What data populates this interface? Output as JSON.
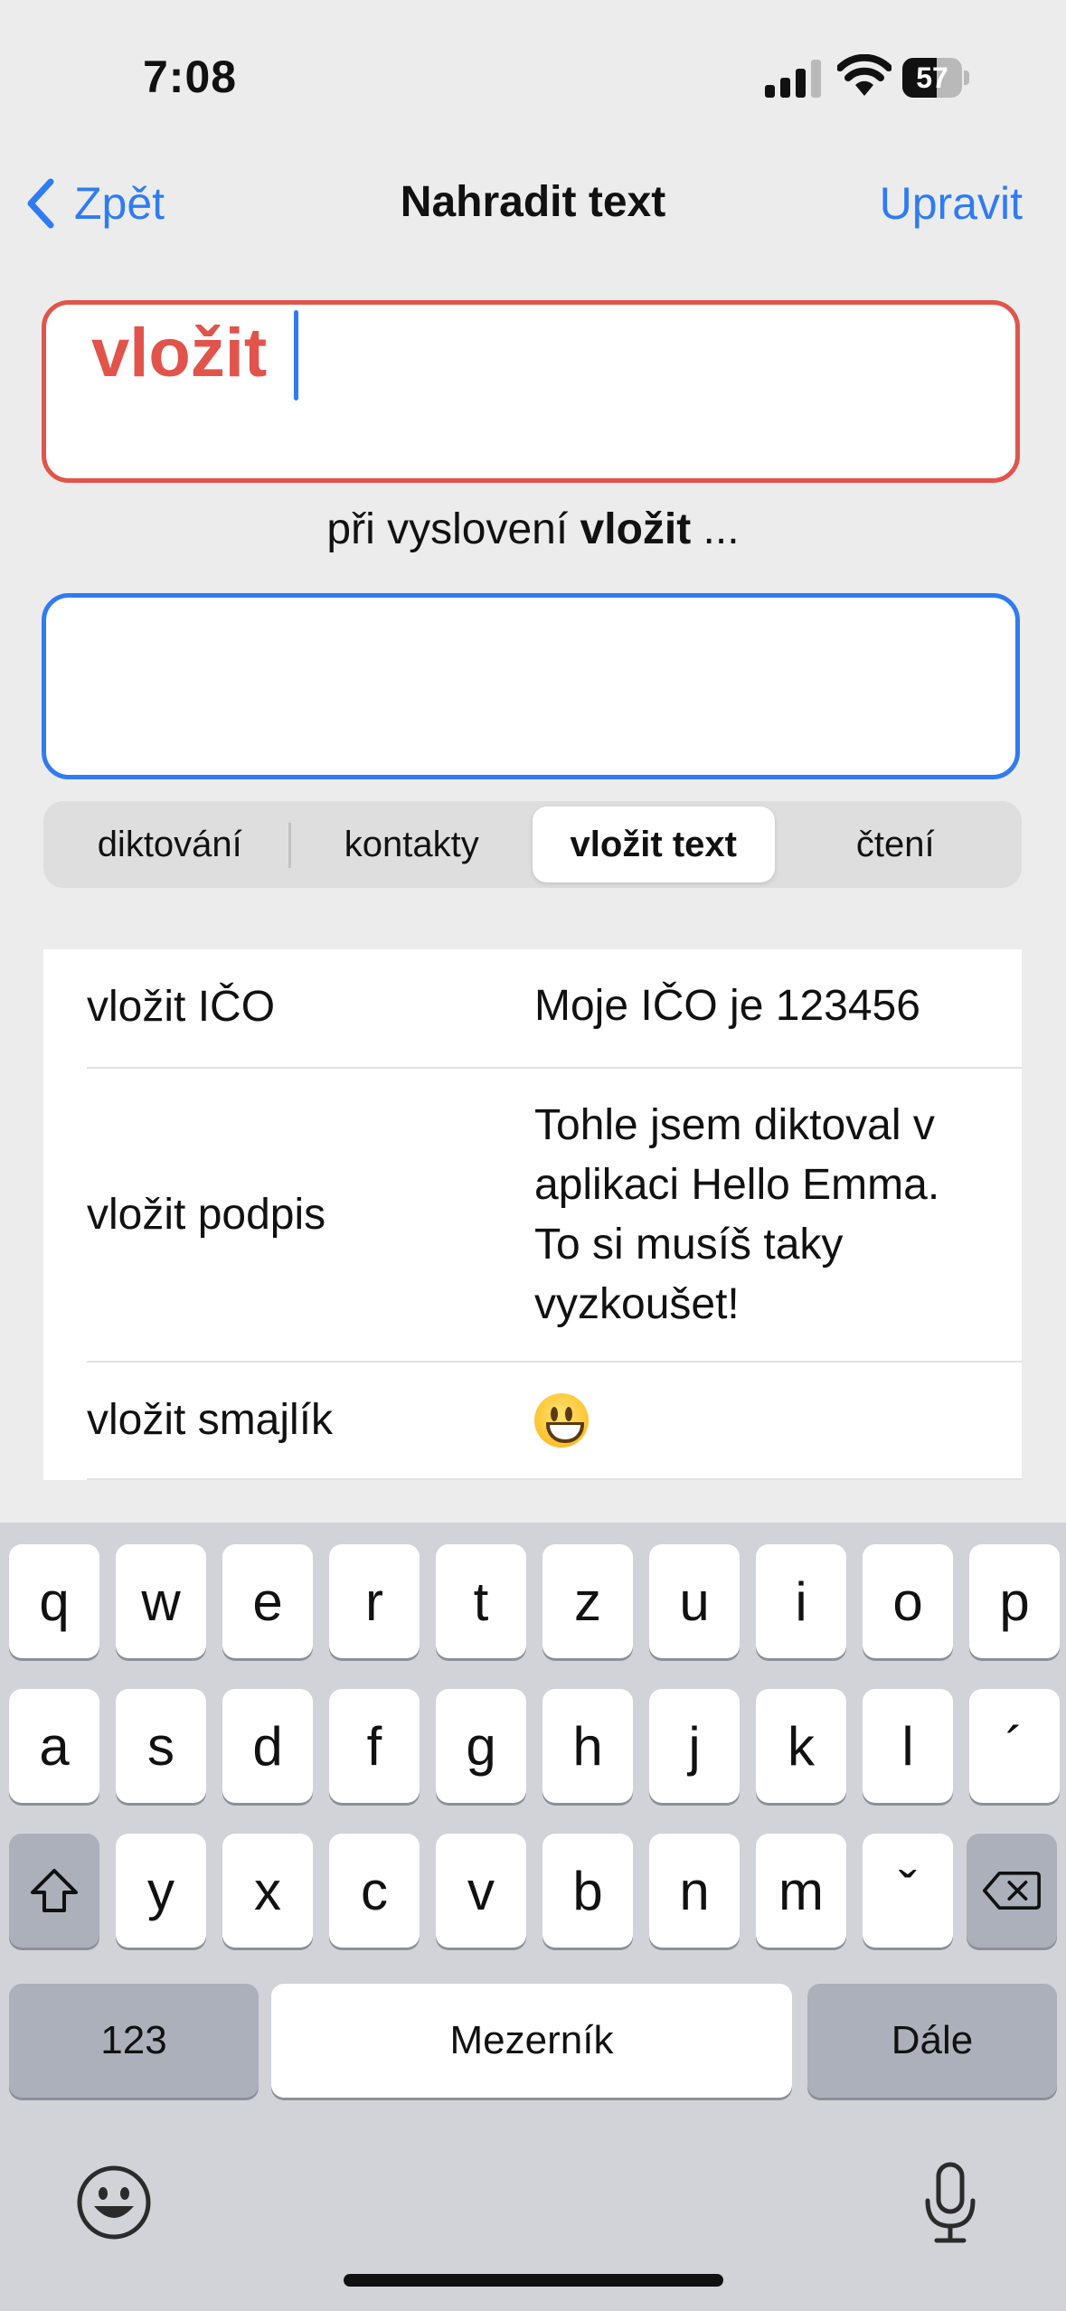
{
  "status_bar": {
    "time": "7:08",
    "battery": "57",
    "battery_level": 0.57
  },
  "nav": {
    "back_label": "Zpět",
    "title": "Nahradit text",
    "edit_label": "Upravit"
  },
  "phrase_field": {
    "value": "vložit"
  },
  "caption": {
    "prefix": "při vyslovení",
    "phrase": "vložit",
    "suffix": "..."
  },
  "replacement_field": {
    "value": ""
  },
  "segments": [
    {
      "label": "diktování",
      "selected": false
    },
    {
      "label": "kontakty",
      "selected": false
    },
    {
      "label": "vložit text",
      "selected": true
    },
    {
      "label": "čtení",
      "selected": false
    }
  ],
  "rows": [
    {
      "phrase": "vložit IČO",
      "text": "Moje IČO je 123456"
    },
    {
      "phrase": "vložit podpis",
      "text": "Tohle jsem diktoval v aplikaci Hello Emma. To si musíš taky vyzkoušet!"
    },
    {
      "phrase": "vložit smajlík",
      "text": "",
      "icon": "grinning-face-emoji"
    }
  ],
  "keyboard": {
    "row1": [
      "q",
      "w",
      "e",
      "r",
      "t",
      "z",
      "u",
      "i",
      "o",
      "p"
    ],
    "row2": [
      "a",
      "s",
      "d",
      "f",
      "g",
      "h",
      "j",
      "k",
      "l",
      "´"
    ],
    "row3": [
      "y",
      "x",
      "c",
      "v",
      "b",
      "n",
      "m",
      "ˇ"
    ],
    "numbers_label": "123",
    "space_label": "Mezerník",
    "return_label": "Dále"
  },
  "colors": {
    "accent": "#2f7bf5",
    "error": "#e2544b"
  }
}
